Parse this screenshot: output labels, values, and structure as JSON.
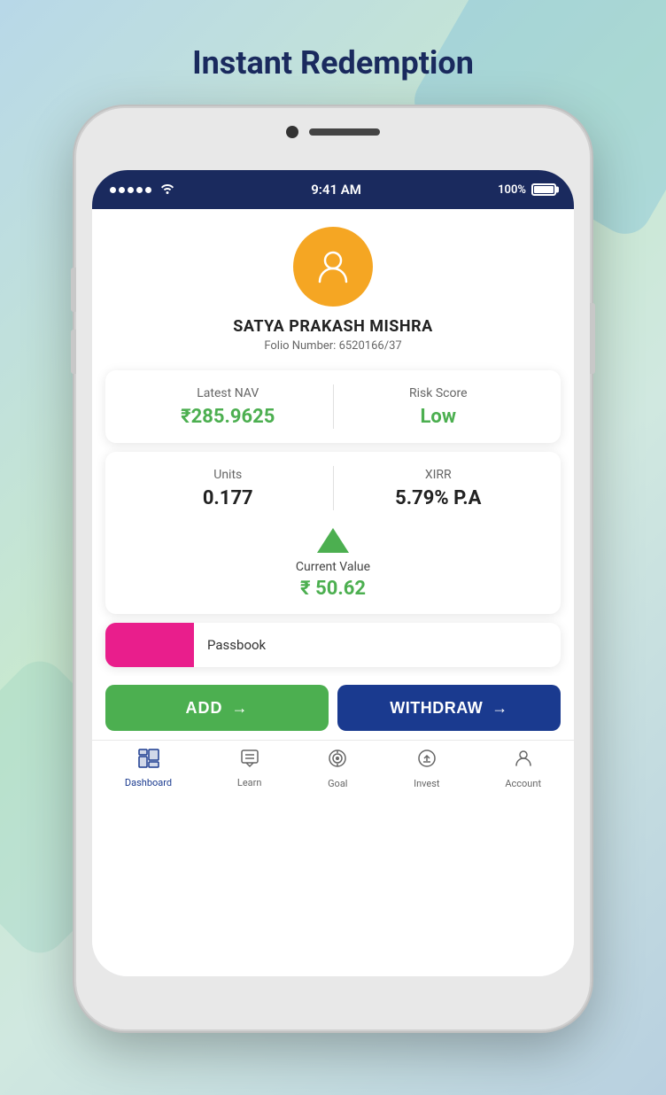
{
  "page": {
    "title": "Instant Redemption"
  },
  "status_bar": {
    "time": "9:41 AM",
    "battery": "100%"
  },
  "profile": {
    "name": "SATYA PRAKASH MISHRA",
    "folio_label": "Folio Number:",
    "folio_number": "6520166/37"
  },
  "nav_card": {
    "latest_nav_label": "Latest NAV",
    "latest_nav_value": "₹285.9625",
    "risk_score_label": "Risk Score",
    "risk_score_value": "Low"
  },
  "units_card": {
    "units_label": "Units",
    "units_value": "0.177",
    "xirr_label": "XIRR",
    "xirr_value": "5.79% P.A",
    "current_value_label": "Current Value",
    "current_value": "₹ 50.62"
  },
  "passbook": {
    "label": "Passbook"
  },
  "buttons": {
    "add_label": "ADD",
    "withdraw_label": "WITHDRAW"
  },
  "bottom_nav": {
    "items": [
      {
        "id": "dashboard",
        "label": "Dashboard",
        "active": true
      },
      {
        "id": "learn",
        "label": "Learn",
        "active": false
      },
      {
        "id": "goal",
        "label": "Goal",
        "active": false
      },
      {
        "id": "invest",
        "label": "Invest",
        "active": false
      },
      {
        "id": "account",
        "label": "Account",
        "active": false
      }
    ]
  }
}
